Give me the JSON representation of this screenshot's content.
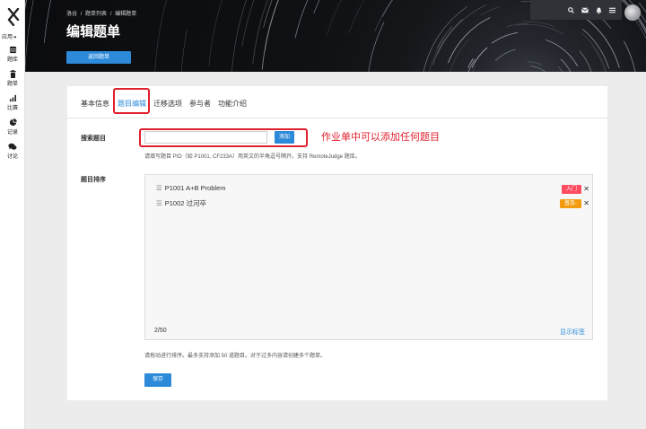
{
  "sidebar": {
    "app_label": "应用",
    "app_arrow": "»",
    "items": [
      {
        "label": "题库",
        "icon": "database-icon"
      },
      {
        "label": "题单",
        "icon": "trash-icon"
      },
      {
        "label": "比赛",
        "icon": "bar-chart-icon"
      },
      {
        "label": "记录",
        "icon": "pie-chart-icon"
      },
      {
        "label": "讨论",
        "icon": "comments-icon"
      }
    ]
  },
  "header": {
    "breadcrumb": [
      "洛谷",
      "题单列表",
      "编辑题单"
    ],
    "breadcrumb_sep": "/",
    "title": "编辑题单",
    "back_button": "返回题单"
  },
  "tabs": [
    {
      "label": "基本信息"
    },
    {
      "label": "题目编辑",
      "active": true
    },
    {
      "label": "迁移选项"
    },
    {
      "label": "参与者"
    },
    {
      "label": "功能介绍"
    }
  ],
  "search": {
    "label": "搜索题目",
    "input_value": "",
    "add_button": "添加",
    "annotation": "作业单中可以添加任何题目",
    "hint": "请填写题目 PID（如 P1001, CF233A）用英文的半角逗号隔开。支持 RemoteJudge 题库。"
  },
  "sort": {
    "label": "题目排序",
    "problems": [
      {
        "text": "P1001 A+B Problem",
        "badge": "入门",
        "badge_color": "#fe4c61"
      },
      {
        "text": "P1002 过河卒",
        "badge": "普及-",
        "badge_color": "#f39c11"
      }
    ],
    "handle_icon": "☰",
    "close_icon": "✕",
    "count": "2/50",
    "show_tags": "显示标签",
    "hint": "请拖动进行排序。最多支持添加 50 道题目。对于过多内容请创建多个题单。"
  },
  "save_button": "保存",
  "colors": {
    "accent": "#2c8ad9",
    "highlight": "#e0202d"
  }
}
